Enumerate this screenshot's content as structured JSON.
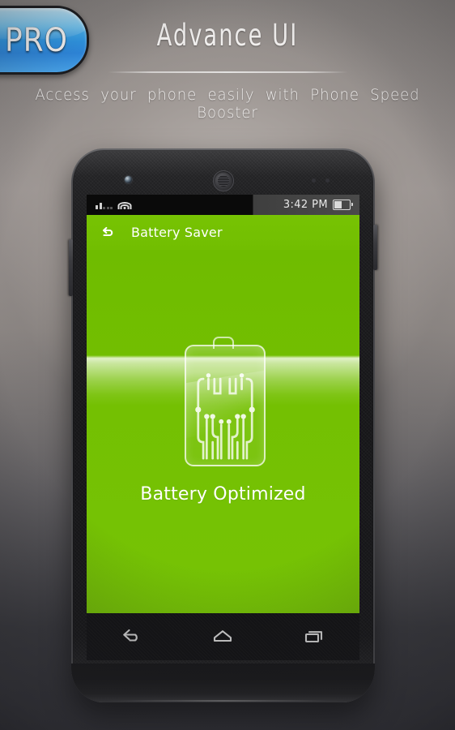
{
  "header": {
    "badge": "PRO",
    "title": "Advance UI",
    "subtitle": "Access your phone easily with Phone Speed Booster"
  },
  "phone": {
    "status_bar": {
      "signal_icon": "signal-bars-icon",
      "wifi_icon": "wifi-icon",
      "time": "3:42 PM",
      "battery_icon": "battery-icon"
    },
    "action_bar": {
      "back_icon": "back-arrow-icon",
      "title": "Battery Saver"
    },
    "content": {
      "battery_graphic": "battery-circuit-icon",
      "status_text": "Battery Optimized"
    },
    "nav_bar": {
      "back": "nav-back-icon",
      "home": "nav-home-icon",
      "recents": "nav-recents-icon"
    },
    "hardware": {
      "front_camera": "front-camera",
      "earpiece": "earpiece-speaker",
      "sensors": "proximity-sensor",
      "power_button": "power-button",
      "volume_button": "volume-button"
    }
  },
  "colors": {
    "accent_green": "#74c002",
    "action_bar_green": "#75c002",
    "badge_blue": "#2f9bec",
    "text_white": "#ffffff",
    "status_bar_dark": "#0a0a0a",
    "nav_bar_dark": "#121214"
  }
}
